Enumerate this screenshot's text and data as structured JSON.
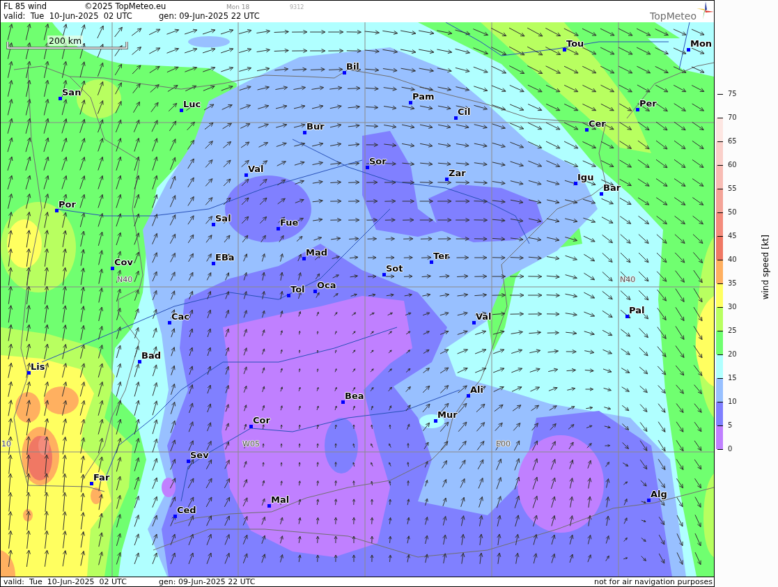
{
  "header": {
    "title": "FL 85 wind",
    "copyright": "©2025 TopMeteo.eu",
    "run": "Mon 18",
    "code": "9312",
    "valid": "valid:  Tue  10-Jun-2025  02 UTC",
    "generated": "gen: 09-Jun-2025 22 UTC",
    "logo": "TopMeteo"
  },
  "map": {
    "scale_bar": "200 km",
    "grid_labels": [
      "N40",
      "N40",
      "10",
      "W05",
      "E00"
    ],
    "cities": [
      "Tou",
      "Mon",
      "Bil",
      "Pam",
      "San",
      "Per",
      "Luc",
      "Cil",
      "Bur",
      "Cer",
      "Sor",
      "Val",
      "Zar",
      "Igu",
      "Bar",
      "Por",
      "Sal",
      "Fue",
      "EBa",
      "Mad",
      "Ter",
      "Cov",
      "Sot",
      "Oca",
      "Tol",
      "Pal",
      "Val",
      "Cac",
      "Bad",
      "Lis",
      "Ali",
      "Bea",
      "Mur",
      "Cor",
      "Sev",
      "Far",
      "Alg",
      "Mal",
      "Ced"
    ]
  },
  "legend": {
    "title": "wind speed [kt]",
    "ticks": [
      "75",
      "70",
      "65",
      "60",
      "55",
      "50",
      "45",
      "40",
      "35",
      "30",
      "25",
      "20",
      "15",
      "10",
      "5",
      "0"
    ],
    "bands": [
      {
        "color": "#fde6e2"
      },
      {
        "color": "#fad0ca"
      },
      {
        "color": "#f8bcb4"
      },
      {
        "color": "#f4a498"
      },
      {
        "color": "#f48c7c"
      },
      {
        "color": "#f07864"
      },
      {
        "color": "#ffb060"
      },
      {
        "color": "#ffff60"
      },
      {
        "color": "#b8ff60"
      },
      {
        "color": "#70ff70"
      },
      {
        "color": "#b0ffff"
      },
      {
        "color": "#98c0ff"
      },
      {
        "color": "#8080ff"
      },
      {
        "color": "#c080ff"
      }
    ]
  },
  "footer": {
    "valid": "valid:  Tue  10-Jun-2025  02 UTC",
    "generated": "gen: 09-Jun-2025 22 UTC",
    "note": "not for air navigation purposes"
  }
}
